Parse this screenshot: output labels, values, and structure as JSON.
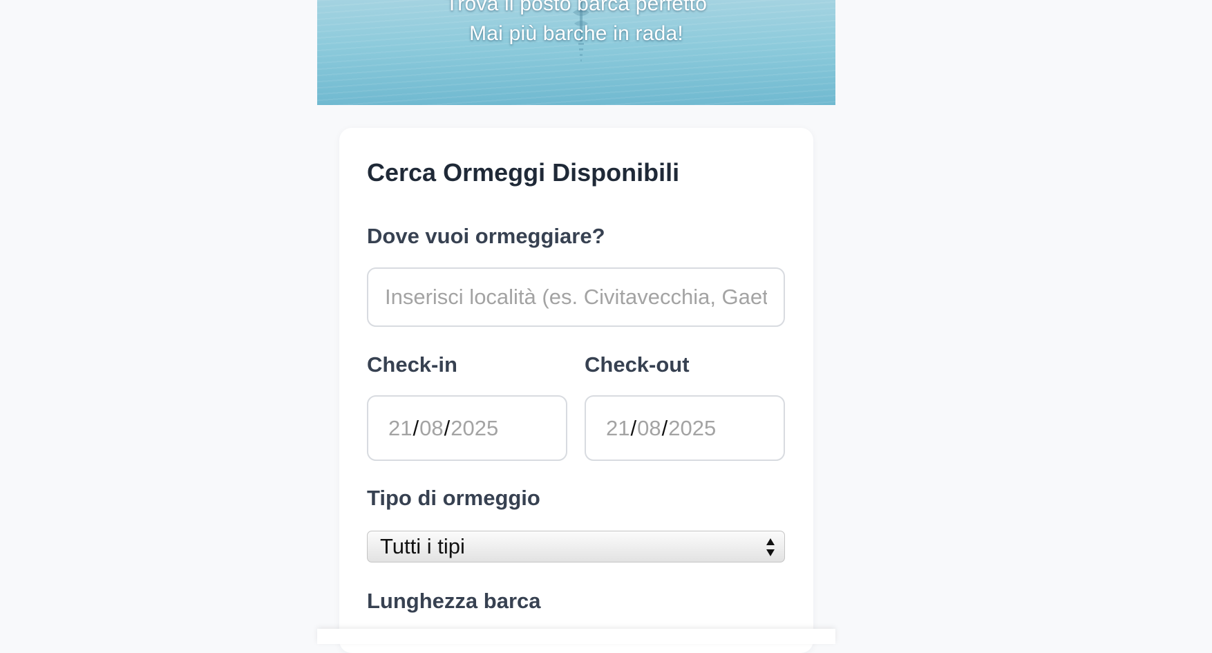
{
  "hero": {
    "line1": "Trova il posto barca perfetto",
    "line2": "Mai più barche in rada!"
  },
  "search": {
    "title": "Cerca Ormeggi Disponibili",
    "location_label": "Dove vuoi ormeggiare?",
    "location_placeholder": "Inserisci località (es. Civitavecchia, Gaeta)",
    "location_value": "",
    "checkin_label": "Check-in",
    "checkout_label": "Check-out",
    "checkin": {
      "day": "21",
      "month": "08",
      "year": "2025"
    },
    "checkout": {
      "day": "21",
      "month": "08",
      "year": "2025"
    },
    "date_separator": "/",
    "type_label": "Tipo di ormeggio",
    "type_selected": "Tutti i tipi",
    "length_label": "Lunghezza barca"
  },
  "colors": {
    "page_background": "#f8f9fb",
    "card_background": "#ffffff",
    "heading": "#1f2937",
    "label": "#374151",
    "placeholder": "#a3a3a3",
    "hero_water": "#8ccadb"
  },
  "icons": {
    "select_arrows": "updown-arrows-icon",
    "hero_decoration": "sailboat-reflection"
  }
}
